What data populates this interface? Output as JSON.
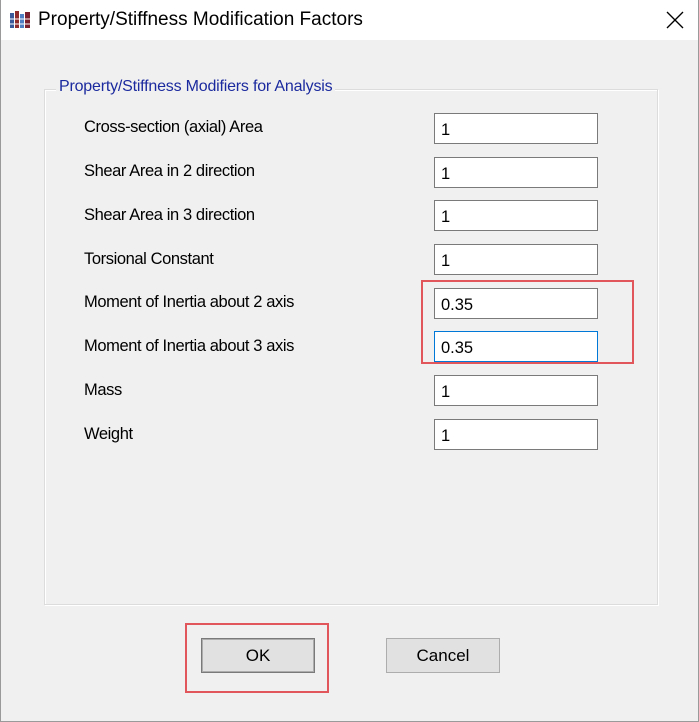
{
  "window": {
    "title": "Property/Stiffness Modification Factors",
    "icon": "etabs-app-icon",
    "close_glyph": "✕"
  },
  "group": {
    "legend": "Property/Stiffness Modifiers for Analysis"
  },
  "rows": [
    {
      "label": "Cross-section (axial) Area",
      "value": "1"
    },
    {
      "label": "Shear Area in 2 direction",
      "value": "1"
    },
    {
      "label": "Shear Area in 3 direction",
      "value": "1"
    },
    {
      "label": "Torsional Constant",
      "value": "1"
    },
    {
      "label": "Moment of Inertia about 2 axis",
      "value": "0.35"
    },
    {
      "label": "Moment of Inertia about 3 axis",
      "value": "0.35"
    },
    {
      "label": "Mass",
      "value": "1"
    },
    {
      "label": "Weight",
      "value": "1"
    }
  ],
  "buttons": {
    "ok": "OK",
    "cancel": "Cancel"
  },
  "colors": {
    "dialog_bg": "#f0f0f0",
    "legend_text": "#1b2a9e",
    "annotation_box": "#e0565b",
    "focus_border": "#0078d7"
  }
}
